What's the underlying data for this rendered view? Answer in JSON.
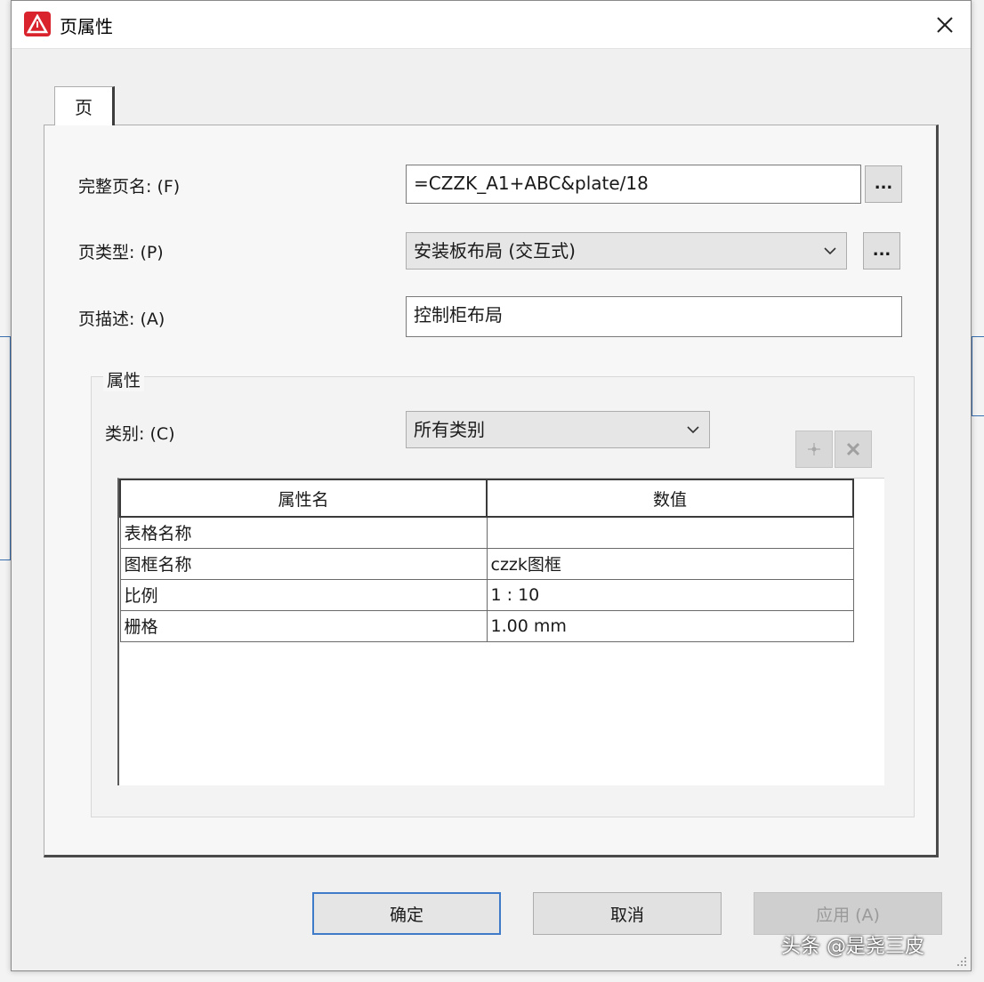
{
  "window": {
    "title": "页属性",
    "close_glyph": "✕"
  },
  "tabs": [
    {
      "label": "页"
    }
  ],
  "form": {
    "full_page_name": {
      "label": "完整页名: (F)",
      "value": "=CZZK_A1+ABC&plate/18"
    },
    "page_type": {
      "label": "页类型: (P)",
      "value": "安装板布局 (交互式)"
    },
    "page_description": {
      "label": "页描述: (A)",
      "value": "控制柜布局"
    },
    "browse_label": "..."
  },
  "properties": {
    "group_title": "属性",
    "category": {
      "label": "类别: (C)",
      "value": "所有类别"
    },
    "table": {
      "columns": [
        "属性名",
        "数值"
      ],
      "rows": [
        {
          "name": "表格名称",
          "value": ""
        },
        {
          "name": "图框名称",
          "value": "czzk图框"
        },
        {
          "name": "比例",
          "value": "1 : 10"
        },
        {
          "name": "栅格",
          "value": "1.00 mm"
        }
      ]
    }
  },
  "buttons": {
    "ok": "确定",
    "cancel": "取消",
    "apply": "应用 (A)"
  },
  "watermark": "头条 @是尧三皮",
  "colors": {
    "brand_red": "#d9232d",
    "focus_blue": "#3f7bc8"
  }
}
